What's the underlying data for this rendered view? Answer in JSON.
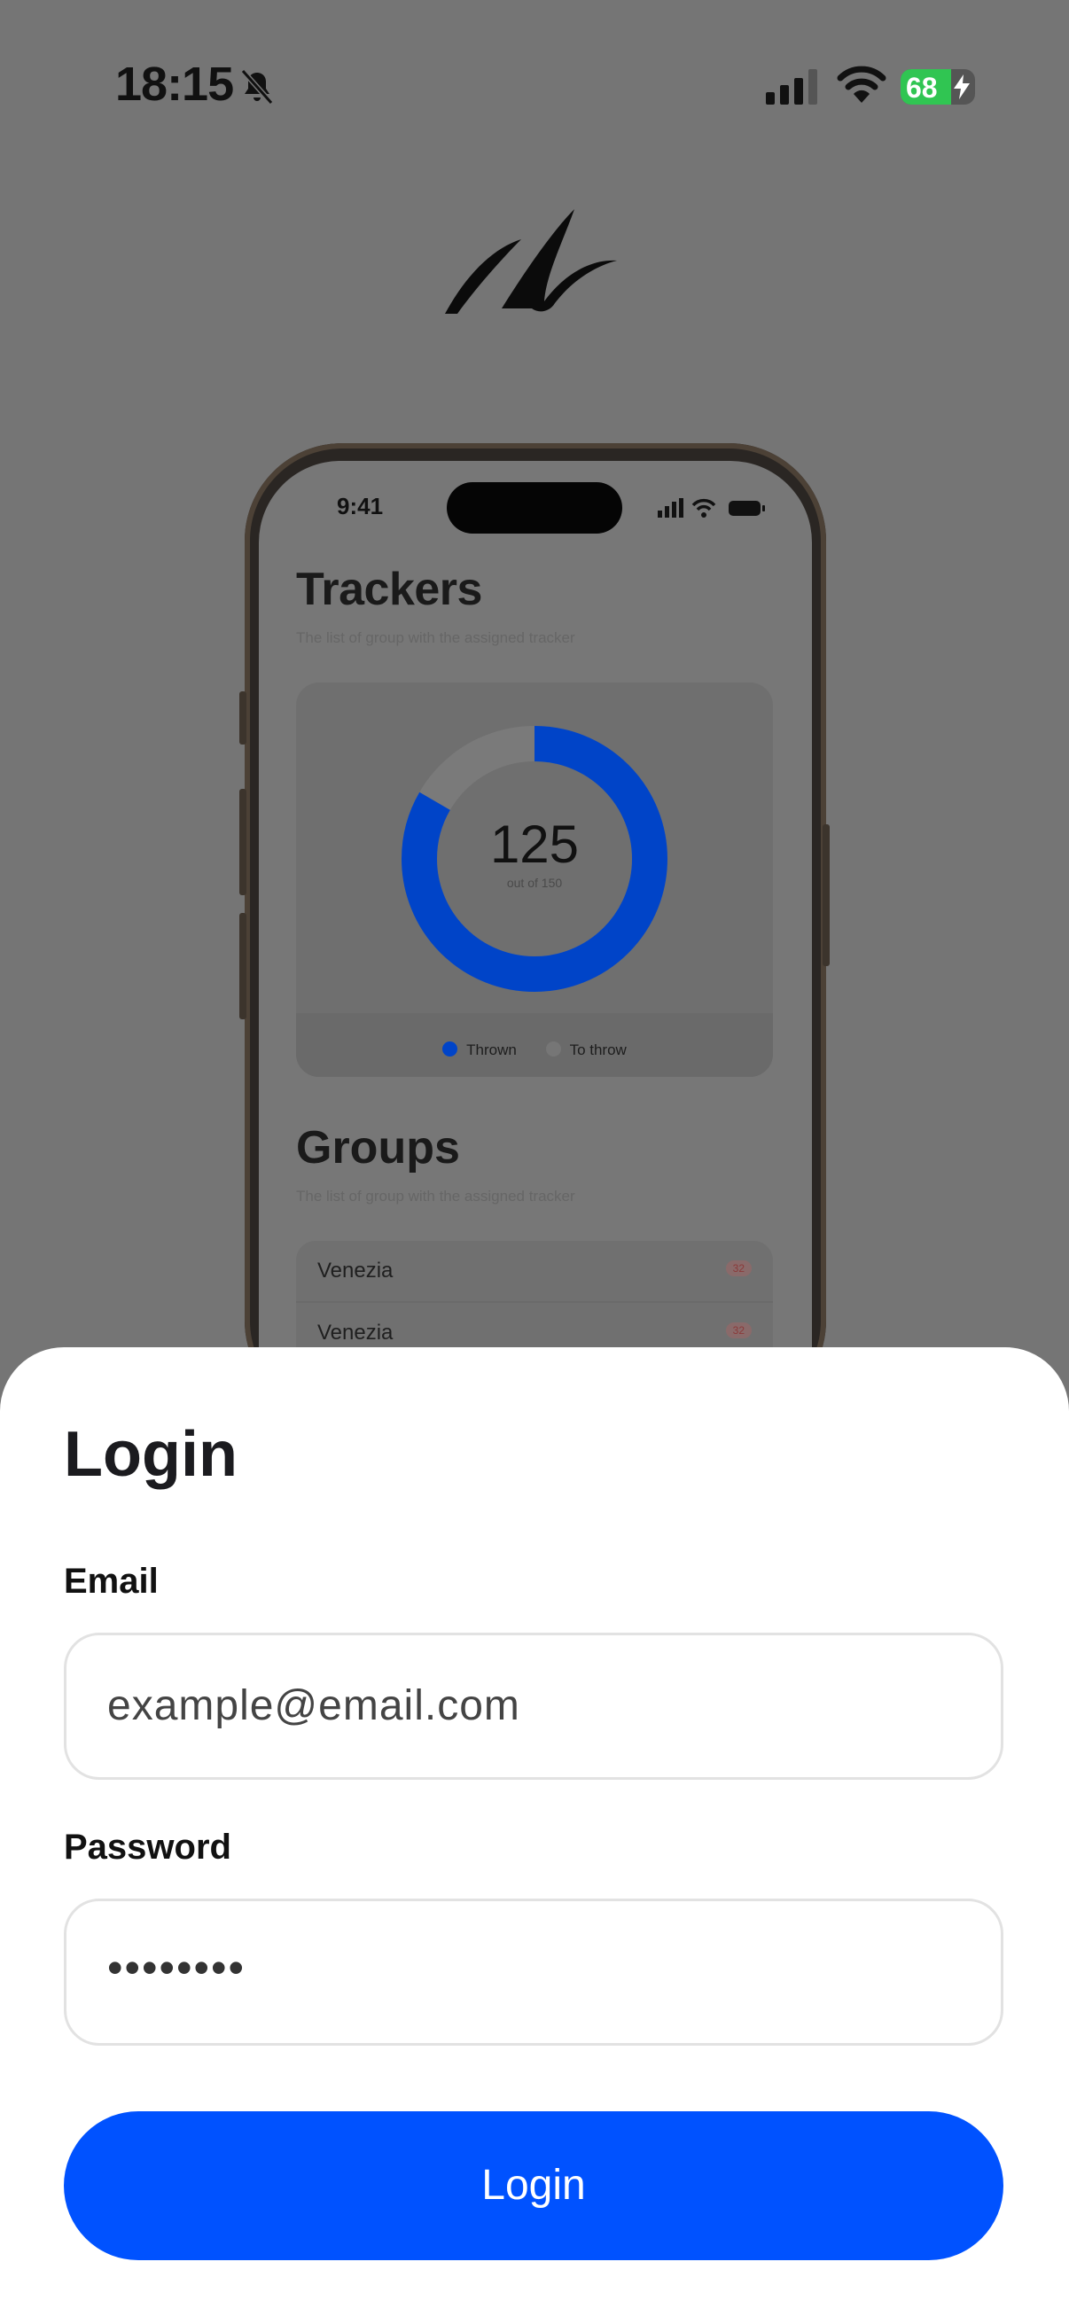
{
  "status_bar": {
    "time": "18:15",
    "battery_percent": "68",
    "battery_level": 0.68,
    "icons": [
      "bell-slash-icon",
      "cellular-signal-icon",
      "wifi-icon",
      "battery-charging-icon"
    ]
  },
  "colors": {
    "accent": "#0052ff",
    "overlay_background": "#757575",
    "donut_thrown": "#0044c8",
    "donut_to_throw": "#e6e6e6",
    "battery_green": "#30c552"
  },
  "preview": {
    "time": "9:41",
    "trackers_title": "Trackers",
    "trackers_subtitle": "The list of group with the assigned tracker",
    "total": "125",
    "total_caption": "out of 150",
    "thrown": 125,
    "out_of": 150,
    "legend": {
      "thrown": "Thrown",
      "to_throw": "To throw"
    },
    "groups_title": "Groups",
    "groups_subtitle": "The list of group with the assigned tracker",
    "groups": [
      {
        "name": "Venezia",
        "count": "32"
      },
      {
        "name": "Venezia",
        "count": "32"
      }
    ]
  },
  "login": {
    "title": "Login",
    "email_label": "Email",
    "email_placeholder": "example@email.com",
    "password_label": "Password",
    "password_value": "••••••••",
    "button_label": "Login"
  }
}
